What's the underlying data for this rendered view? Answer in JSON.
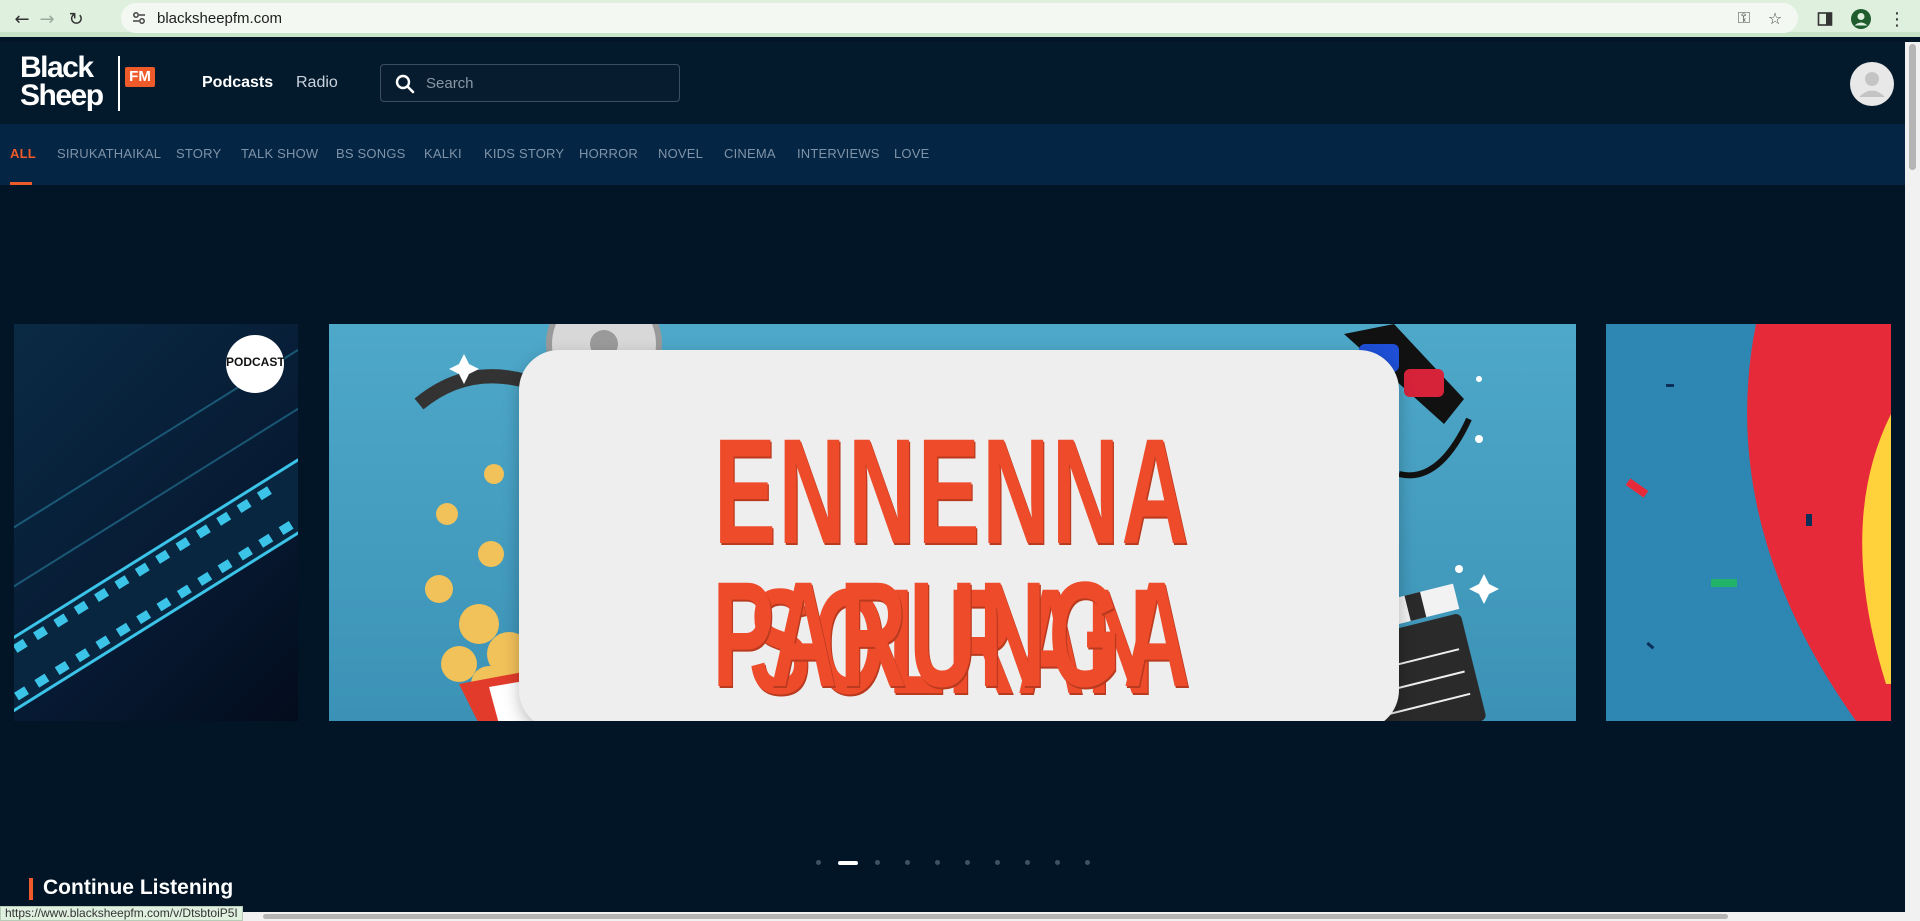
{
  "browser": {
    "url": "blacksheepfm.com",
    "status_url": "https://www.blacksheepfm.com/v/DtsbtoiP5I"
  },
  "header": {
    "logo_black": "Black",
    "logo_sheep": "Sheep",
    "logo_fm": "FM",
    "nav": [
      "Podcasts",
      "Radio"
    ],
    "active_nav": "Podcasts",
    "search_placeholder": "Search"
  },
  "categories": {
    "active": "ALL",
    "items": [
      "ALL",
      "SIRUKATHAIKAL",
      "STORY",
      "TALK SHOW",
      "BS SONGS",
      "KALKI",
      "KIDS STORY",
      "HORROR",
      "NOVEL",
      "CINEMA",
      "INTERVIEWS",
      "LOVE"
    ]
  },
  "carousel": {
    "banner_line1": "ENNENNA SOLRAN",
    "banner_line2": "PARUNGA",
    "left_badge_text": "PODCAST",
    "dot_count": 10,
    "active_dot": 1
  },
  "sections": {
    "continue_listening": "Continue Listening"
  },
  "colors": {
    "accent": "#ef5a2a",
    "background": "#021526",
    "category_bar": "#042543",
    "banner_bg": "#4ea8c9"
  }
}
